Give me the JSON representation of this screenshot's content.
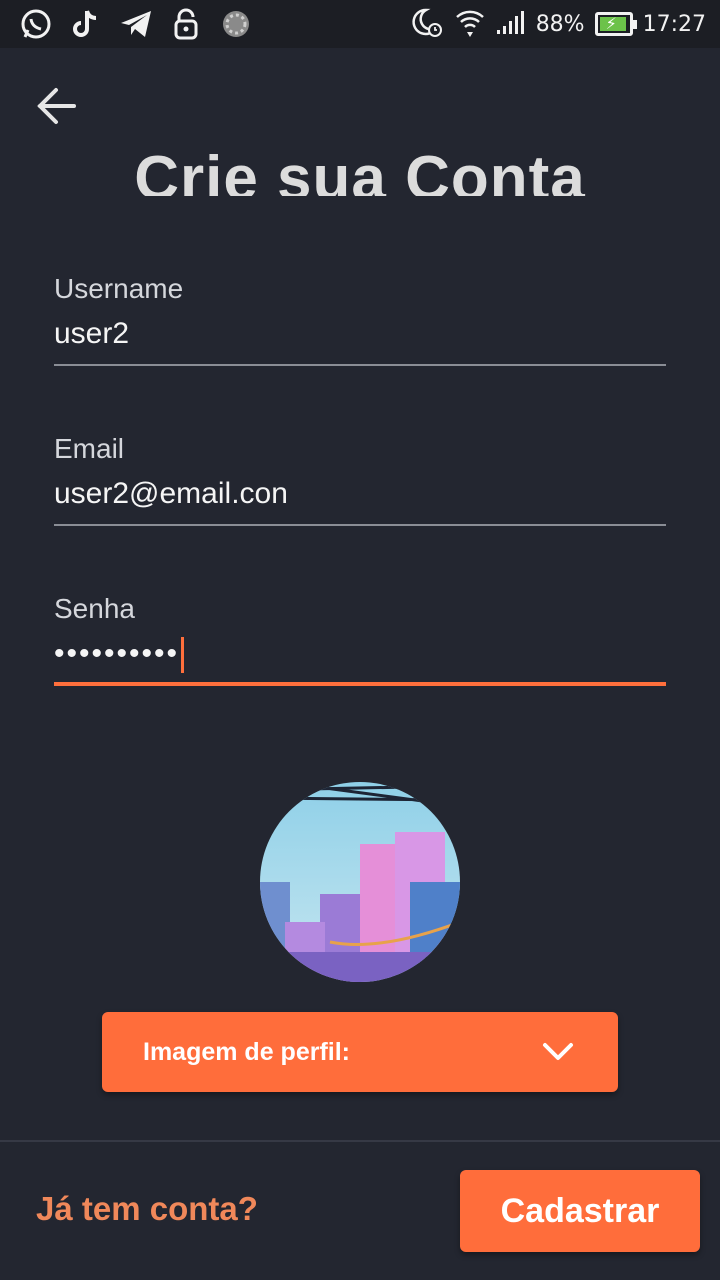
{
  "status_bar": {
    "battery_percent": "88%",
    "time": "17:27",
    "left_icons": [
      "whatsapp-icon",
      "tiktok-icon",
      "telegram-icon",
      "lock-icon",
      "loading-icon"
    ],
    "right_icons": [
      "moon-alarm-icon",
      "wifi-icon",
      "signal-icon",
      "battery-charging-icon"
    ]
  },
  "header": {
    "title": "Crie sua Conta"
  },
  "form": {
    "username": {
      "label": "Username",
      "value": "user2"
    },
    "email": {
      "label": "Email",
      "value": "user2@email.con"
    },
    "password": {
      "label": "Senha",
      "value": "••••••••••"
    }
  },
  "profile": {
    "dropdown_label": "Imagem de perfil:"
  },
  "footer": {
    "login_link": "Já tem conta?",
    "submit_label": "Cadastrar"
  },
  "colors": {
    "accent": "#ff6d3b",
    "background": "#232630",
    "link": "#f0885a"
  }
}
